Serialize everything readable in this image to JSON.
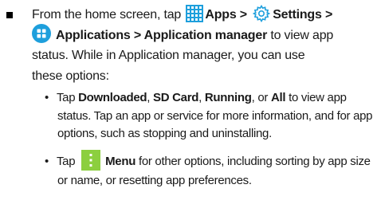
{
  "bullet": {
    "line1_pre": "From the home screen, tap ",
    "apps": "Apps",
    "sep1": " > ",
    "settings": "Settings",
    "sep2": " >",
    "line2_bold": "Applications > Application manager",
    "line2_rest": " to view app",
    "line3": "status. While in Application manager, you can use",
    "line4": "these options:"
  },
  "sub1": {
    "pre": "Tap ",
    "downloaded": "Downloaded",
    "comma1": ", ",
    "sdcard": "SD Card",
    "comma2": ", ",
    "running": "Running",
    "or": ", or ",
    "all": "All",
    "rest": " to view app",
    "line2": "status. Tap an app or service for more information, and for app",
    "line3": "options, such as stopping and uninstalling."
  },
  "sub2": {
    "pre": "Tap ",
    "menu": "Menu",
    "rest": " for other options, including sorting by app size",
    "line2": "or name, or resetting app preferences."
  },
  "icons": {
    "apps": "apps-grid-icon",
    "settings": "settings-gear-icon",
    "applications": "applications-icon",
    "menu": "menu-icon"
  },
  "colors": {
    "icon_blue": "#1e9fdc",
    "menu_green": "#8ccf3f"
  }
}
